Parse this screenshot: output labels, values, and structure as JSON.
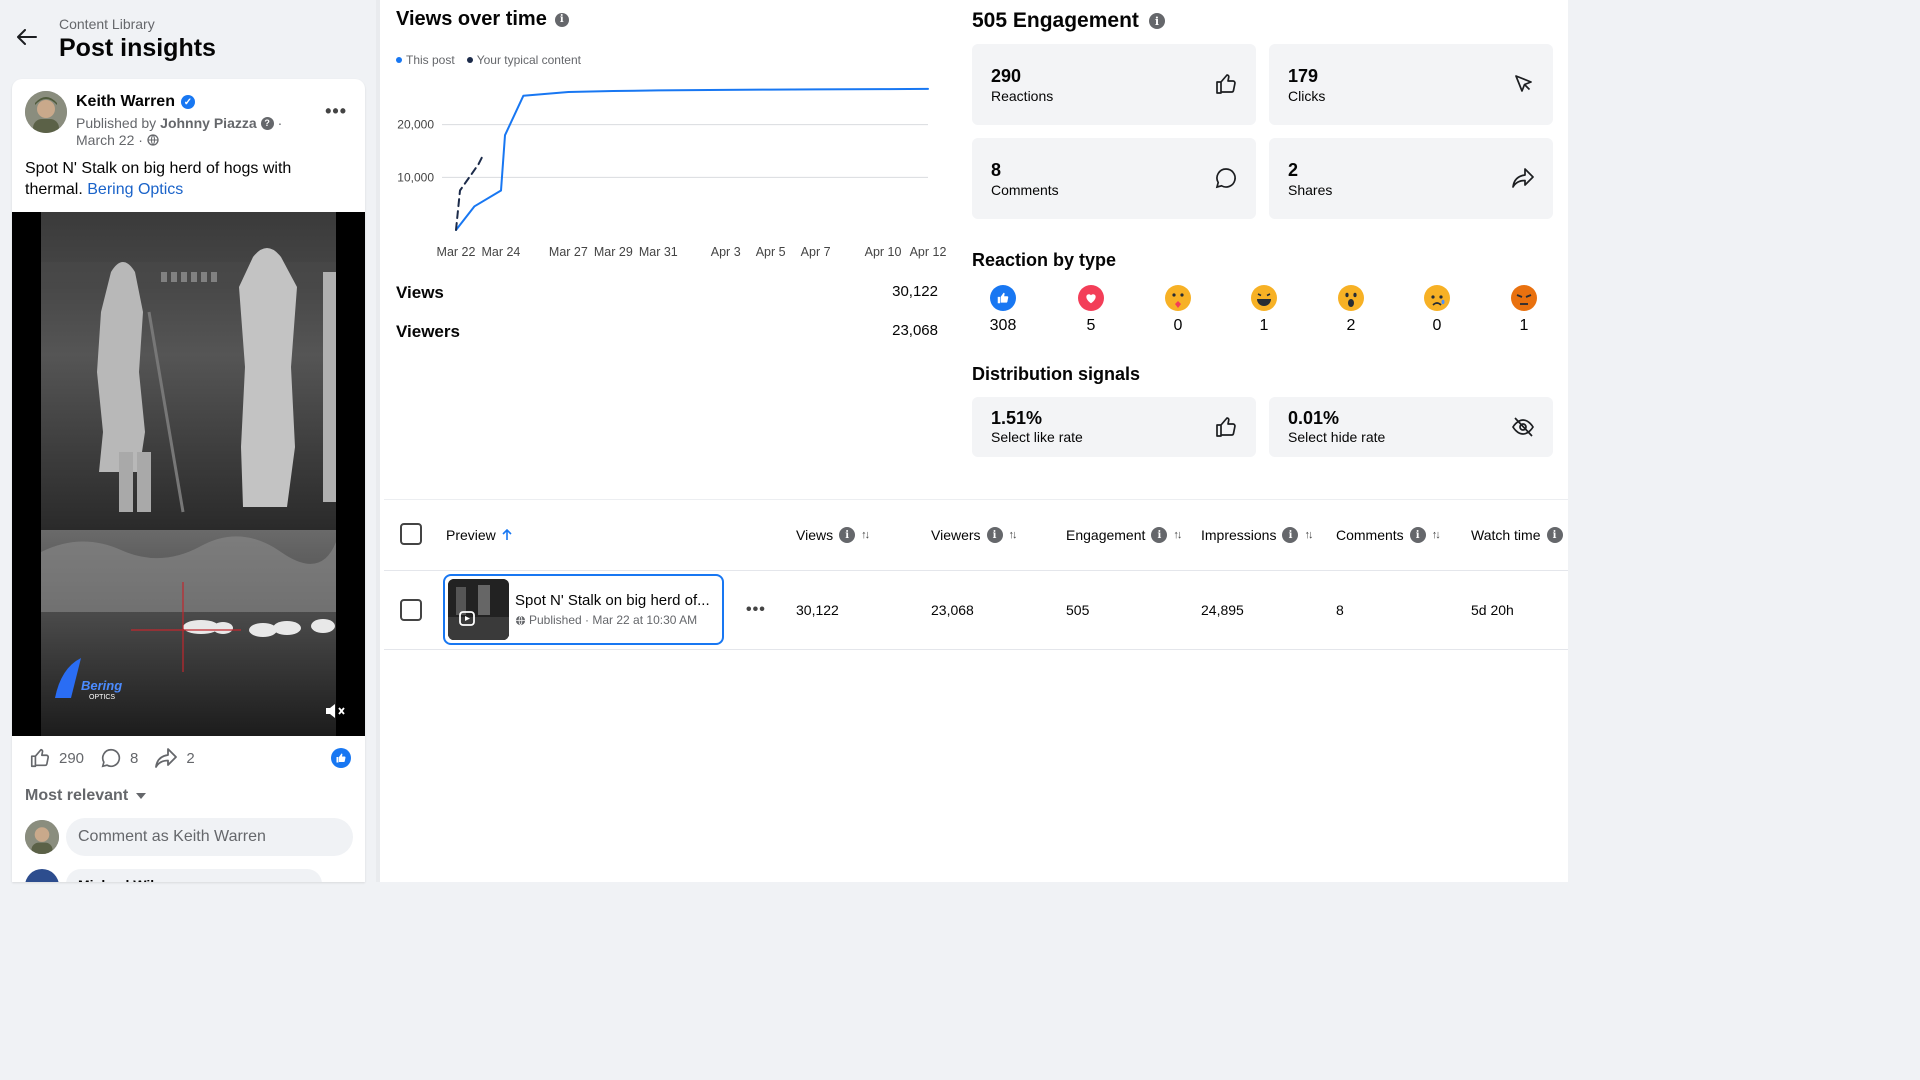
{
  "header": {
    "breadcrumb": "Content Library",
    "title": "Post insights"
  },
  "post": {
    "author": "Keith Warren",
    "published_prefix": "Published by",
    "published_by": "Johnny Piazza",
    "date": "March 22 ·",
    "text": "Spot N' Stalk on big herd of hogs with thermal.",
    "link_text": "Bering Optics",
    "watermark_line1": "Bering",
    "watermark_line2": "OPTICS",
    "reactions": "290",
    "comments": "8",
    "shares": "2",
    "sort_label": "Most relevant",
    "comment_placeholder": "Comment as Keith Warren",
    "next_comment_author": "Michael Wil..."
  },
  "views_chart": {
    "title": "Views over time",
    "legend": [
      "This post",
      "Your typical content"
    ],
    "stats": [
      {
        "label": "Views",
        "value": "30,122"
      },
      {
        "label": "Viewers",
        "value": "23,068"
      }
    ]
  },
  "chart_data": {
    "type": "line",
    "title": "Views over time",
    "x_ticks": [
      "Mar 22",
      "Mar 24",
      "Mar 27",
      "Mar 29",
      "Mar 31",
      "Apr 3",
      "Apr 5",
      "Apr 7",
      "Apr 10",
      "Apr 12"
    ],
    "y_ticks": [
      10000,
      20000
    ],
    "y_tick_labels": [
      "10,000",
      "20,000"
    ],
    "ylim": [
      0,
      30000
    ],
    "grid": true,
    "legend_position": "top-left",
    "series": [
      {
        "name": "This post",
        "color": "#1877f2",
        "style": "solid",
        "x": [
          "Mar 22",
          "Mar 23",
          "Mar 24",
          "Mar 24",
          "Mar 25",
          "Mar 27",
          "Mar 29",
          "Mar 31",
          "Apr 3",
          "Apr 5",
          "Apr 7",
          "Apr 10",
          "Apr 12"
        ],
        "values": [
          0,
          4500,
          7500,
          18000,
          25500,
          26200,
          26400,
          26500,
          26600,
          26650,
          26700,
          26750,
          26800
        ]
      },
      {
        "name": "Your typical content",
        "color": "#1c2b4a",
        "style": "dashed",
        "x": [
          "Mar 22",
          "Mar 22",
          "Mar 23",
          "Mar 23"
        ],
        "values": [
          0,
          7500,
          12500,
          14000
        ]
      }
    ]
  },
  "engagement": {
    "title": "505 Engagement",
    "metrics": [
      {
        "value": "290",
        "label": "Reactions",
        "icon": "thumbs-up-icon"
      },
      {
        "value": "179",
        "label": "Clicks",
        "icon": "cursor-click-icon"
      },
      {
        "value": "8",
        "label": "Comments",
        "icon": "comment-bubble-icon"
      },
      {
        "value": "2",
        "label": "Shares",
        "icon": "share-arrow-icon"
      }
    ]
  },
  "reactions_by_type": {
    "title": "Reaction by type",
    "items": [
      {
        "type": "like",
        "count": "308",
        "color": "#1877f2"
      },
      {
        "type": "love",
        "count": "5",
        "color": "#f33e58"
      },
      {
        "type": "care",
        "count": "0",
        "color": "#f7b125"
      },
      {
        "type": "haha",
        "count": "1",
        "color": "#f7b125"
      },
      {
        "type": "wow",
        "count": "2",
        "color": "#f7b125"
      },
      {
        "type": "sad",
        "count": "0",
        "color": "#f7b125"
      },
      {
        "type": "angry",
        "count": "1",
        "color": "#e9710f"
      }
    ]
  },
  "distribution": {
    "title": "Distribution signals",
    "signals": [
      {
        "value": "1.51%",
        "label": "Select like rate",
        "icon": "thumbs-up-icon"
      },
      {
        "value": "0.01%",
        "label": "Select hide rate",
        "icon": "eye-off-icon"
      }
    ]
  },
  "table": {
    "columns": [
      "Preview",
      "Views",
      "Viewers",
      "Engagement",
      "Impressions",
      "Comments",
      "Watch time"
    ],
    "rows": [
      {
        "title": "Spot N' Stalk on big herd of...",
        "status": "Published · Mar 22 at 10:30 AM",
        "views": "30,122",
        "viewers": "23,068",
        "engagement": "505",
        "impressions": "24,895",
        "comments": "8",
        "watch_time": "5d 20h"
      }
    ]
  }
}
